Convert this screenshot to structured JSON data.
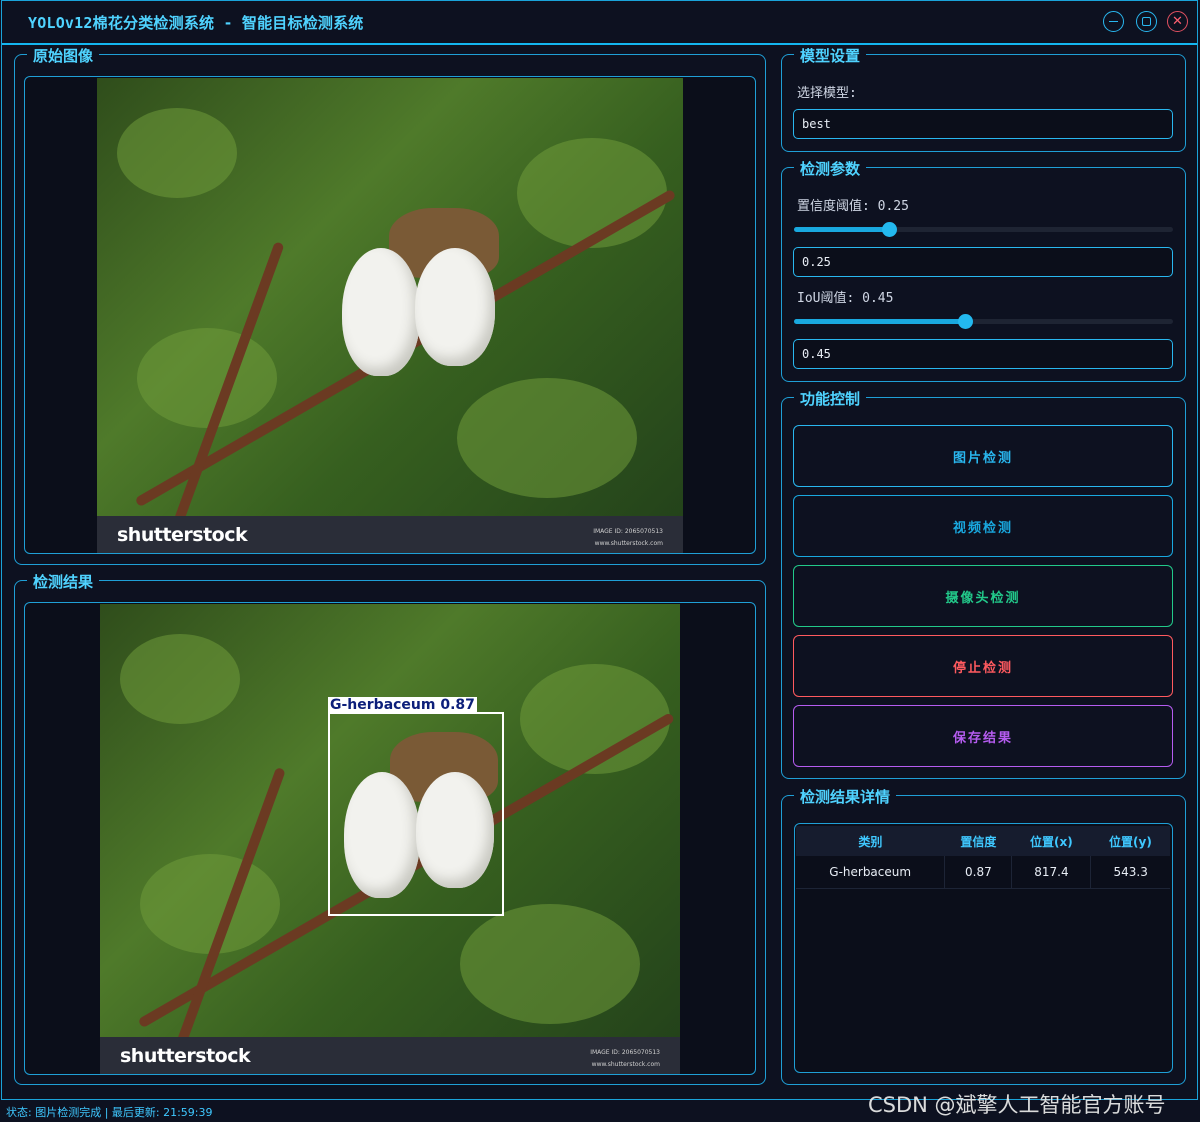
{
  "window": {
    "title": "YOLOv12棉花分类检测系统 - 智能目标检测系统"
  },
  "original_panel": {
    "title": "原始图像",
    "watermark_logo": "shutterstock",
    "watermark_id": "IMAGE ID: 2065070513",
    "watermark_url": "www.shutterstock.com"
  },
  "result_panel": {
    "title": "检测结果",
    "detection_label": "G-herbaceum  0.87",
    "watermark_logo": "shutterstock",
    "watermark_id": "IMAGE ID: 2065070513",
    "watermark_url": "www.shutterstock.com"
  },
  "model_settings": {
    "title": "模型设置",
    "select_label": "选择模型:",
    "selected_model": "best"
  },
  "detection_params": {
    "title": "检测参数",
    "confidence_label": "置信度阈值: 0.25",
    "confidence_value": "0.25",
    "confidence_fraction": 0.25,
    "iou_label": "IoU阈值: 0.45",
    "iou_value": "0.45",
    "iou_fraction": 0.45
  },
  "function_control": {
    "title": "功能控制",
    "buttons": [
      {
        "label": "图片检测",
        "color": "#29b7ef"
      },
      {
        "label": "视频检测",
        "color": "#19a8df"
      },
      {
        "label": "摄像头检测",
        "color": "#22c98a"
      },
      {
        "label": "停止检测",
        "color": "#ff5a5f"
      },
      {
        "label": "保存结果",
        "color": "#b55cf0"
      }
    ]
  },
  "result_details": {
    "title": "检测结果详情",
    "columns": [
      "类别",
      "置信度",
      "位置(x)",
      "位置(y)"
    ],
    "rows": [
      [
        "G-herbaceum",
        "0.87",
        "817.4",
        "543.3"
      ]
    ]
  },
  "status_bar": {
    "text": "状态: 图片检测完成 | 最后更新: 21:59:39"
  },
  "csdn_watermark": "CSDN @斌擎人工智能官方账号",
  "colors": {
    "accent": "#29b7ef",
    "background": "#0d1120",
    "stop": "#ff5a5f",
    "camera": "#22c98a",
    "save": "#b55cf0"
  }
}
